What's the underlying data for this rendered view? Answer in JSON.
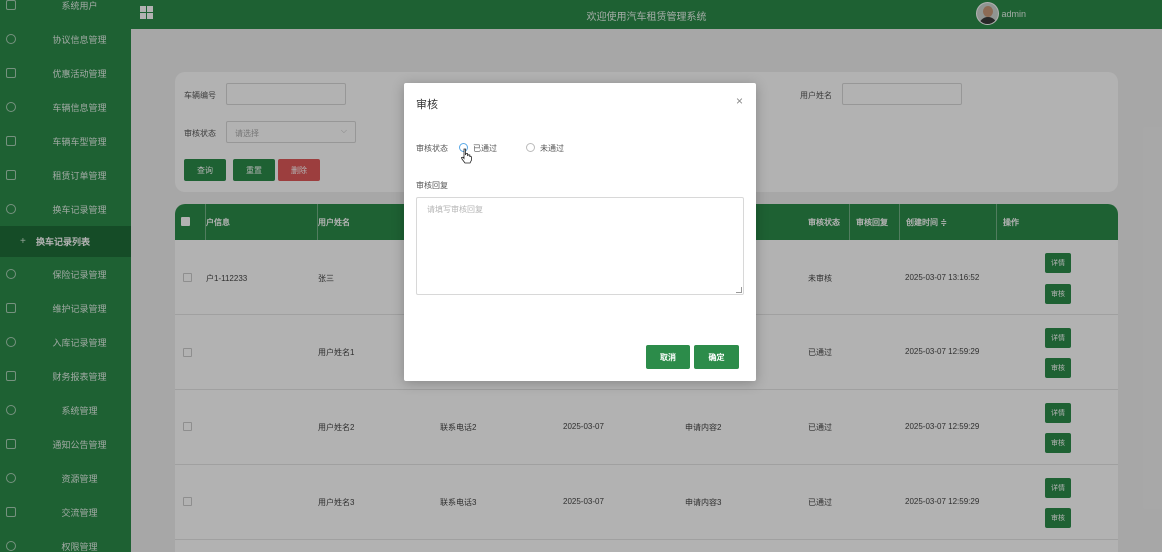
{
  "header": {
    "title": "欢迎使用汽车租赁管理系统",
    "username": "admin"
  },
  "sidebar": {
    "items": [
      {
        "label": "系统用户",
        "icon": "grid-icon"
      },
      {
        "label": "协议信息管理",
        "icon": "chat-icon"
      },
      {
        "label": "优惠活动管理",
        "icon": "doc-icon"
      },
      {
        "label": "车辆信息管理",
        "icon": "shield-icon"
      },
      {
        "label": "车辆车型管理",
        "icon": "columns-icon"
      },
      {
        "label": "租赁订单管理",
        "icon": "doc-icon"
      },
      {
        "label": "换车记录管理",
        "icon": "chat-icon"
      },
      {
        "label": "换车记录列表",
        "icon": "plus-icon",
        "active": true
      },
      {
        "label": "保险记录管理",
        "icon": "shield-icon"
      },
      {
        "label": "维护记录管理",
        "icon": "doc-icon"
      },
      {
        "label": "入库记录管理",
        "icon": "shield-icon"
      },
      {
        "label": "财务报表管理",
        "icon": "columns-icon"
      },
      {
        "label": "系统管理",
        "icon": "chat-icon"
      },
      {
        "label": "通知公告管理",
        "icon": "columns-icon"
      },
      {
        "label": "资源管理",
        "icon": "shield-icon"
      },
      {
        "label": "交流管理",
        "icon": "doc-icon"
      },
      {
        "label": "权限管理",
        "icon": "shield-icon"
      }
    ]
  },
  "search": {
    "vehicle_no_label": "车辆编号",
    "username_label": "用户姓名",
    "status_label": "审核状态",
    "status_placeholder": "请选择",
    "query_btn": "查询",
    "reset_btn": "重置",
    "delete_btn": "删除"
  },
  "table": {
    "headers": [
      "户信息",
      "用户姓名",
      "审核状态",
      "审核回复",
      "创建时间 ≑",
      "操作"
    ],
    "rows": [
      {
        "info": "户1-112233",
        "name": "张三",
        "phone": "",
        "date": "",
        "content": "",
        "status": "未审核",
        "created": "2025-03-07 13:16:52"
      },
      {
        "info": "",
        "name": "用户姓名1",
        "phone": "",
        "date": "",
        "content": "",
        "status": "已通过",
        "created": "2025-03-07 12:59:29"
      },
      {
        "info": "",
        "name": "用户姓名2",
        "phone": "联系电话2",
        "date": "2025-03-07",
        "content": "申请内容2",
        "status": "已通过",
        "created": "2025-03-07 12:59:29"
      },
      {
        "info": "",
        "name": "用户姓名3",
        "phone": "联系电话3",
        "date": "2025-03-07",
        "content": "申请内容3",
        "status": "已通过",
        "created": "2025-03-07 12:59:29"
      }
    ],
    "detail_btn": "详情",
    "review_btn": "审核"
  },
  "modal": {
    "title": "审核",
    "close": "×",
    "status_label": "审核状态",
    "option_pass": "已通过",
    "option_fail": "未通过",
    "reply_label": "审核回复",
    "reply_placeholder": "请填写审核回复",
    "cancel_btn": "取消",
    "confirm_btn": "确定"
  },
  "colors": {
    "primary": "#2c8c4a",
    "danger": "#e05a5a"
  }
}
